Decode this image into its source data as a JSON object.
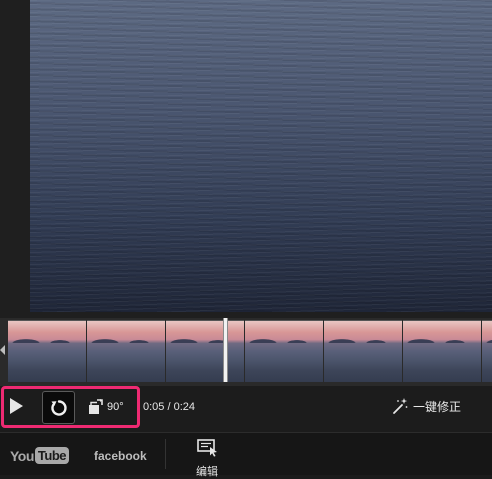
{
  "controls": {
    "rotate_label": "90°",
    "current_time": "0:05",
    "time_separator": " / ",
    "total_time": "0:24",
    "auto_fix_label": "一键修正"
  },
  "share": {
    "youtube_you": "You",
    "youtube_tube": "Tube",
    "facebook_label": "facebook",
    "edit_label": "编辑"
  },
  "filmstrip": {
    "frame_count": 7
  },
  "colors": {
    "highlight": "#ee2a72",
    "background": "#1b1b1b"
  },
  "icons": {
    "play": "play-icon",
    "rotate": "rotate-icon",
    "rotate_90": "rotate-90-icon",
    "auto_fix": "magic-wand-icon",
    "edit": "edit-icon"
  }
}
